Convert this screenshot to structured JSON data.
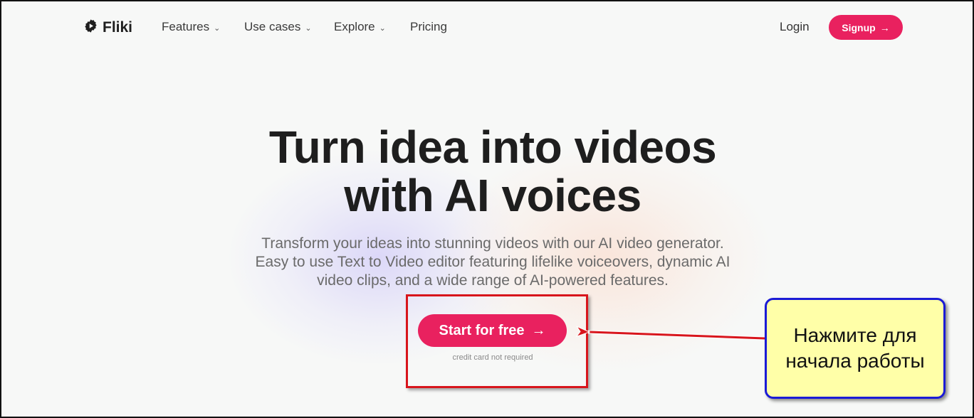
{
  "brand": {
    "name": "Fliki",
    "icon": "play-gear-icon"
  },
  "nav": {
    "items": [
      {
        "label": "Features",
        "dropdown": true
      },
      {
        "label": "Use cases",
        "dropdown": true
      },
      {
        "label": "Explore",
        "dropdown": true
      },
      {
        "label": "Pricing",
        "dropdown": false
      }
    ],
    "login": "Login",
    "signup": "Signup",
    "signup_icon": "arrow-right-icon"
  },
  "hero": {
    "title_line1": "Turn idea into videos",
    "title_line2": "with AI voices",
    "subtitle_line1": "Transform your ideas into stunning videos with our AI video generator.",
    "subtitle_line2": "Easy to use Text to Video editor featuring lifelike voiceovers, dynamic AI",
    "subtitle_line3": "video clips, and a wide range of AI-powered features.",
    "cta": "Start for free",
    "cta_icon": "arrow-right-icon",
    "cta_note": "credit card not required"
  },
  "annotation": {
    "line1": "Нажмите для",
    "line2": "начала работы",
    "box_color": "#ffffa8",
    "border_color": "#1b1bd6",
    "highlight_color": "#d8151c"
  },
  "colors": {
    "accent": "#e9215f",
    "text": "#1e1e1e",
    "muted": "#6a6a6a"
  }
}
